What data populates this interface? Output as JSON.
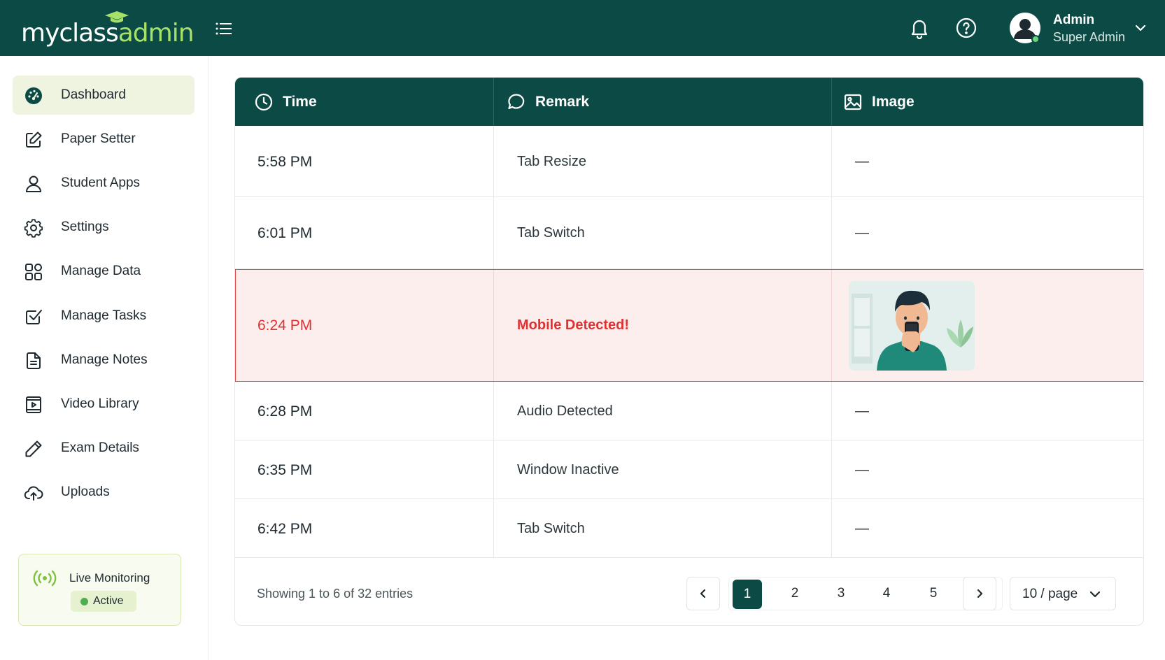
{
  "app": {
    "logo_main": "myclass",
    "logo_accent": "admin"
  },
  "header": {
    "user_name": "Admin",
    "user_role": "Super Admin"
  },
  "sidebar": {
    "items": [
      {
        "label": "Dashboard",
        "icon": "dashboard-icon",
        "active": true
      },
      {
        "label": "Paper Setter",
        "icon": "edit-icon"
      },
      {
        "label": "Student Apps",
        "icon": "user-icon"
      },
      {
        "label": "Settings",
        "icon": "gear-icon"
      },
      {
        "label": "Manage Data",
        "icon": "grid-icon"
      },
      {
        "label": "Manage Tasks",
        "icon": "checkbox-icon"
      },
      {
        "label": "Manage Notes",
        "icon": "note-icon"
      },
      {
        "label": "Video Library",
        "icon": "video-icon"
      },
      {
        "label": "Exam Details",
        "icon": "pencil-icon"
      },
      {
        "label": "Uploads",
        "icon": "upload-cloud-icon"
      }
    ],
    "live": {
      "label": "Live Monitoring",
      "status": "Active"
    }
  },
  "table": {
    "columns": {
      "time": "Time",
      "remark": "Remark",
      "image": "Image"
    },
    "rows": [
      {
        "time": "5:58 PM",
        "remark": "Tab Resize",
        "image": "—"
      },
      {
        "time": "6:01 PM",
        "remark": "Tab Switch",
        "image": "—"
      },
      {
        "time": "6:24 PM",
        "remark": "Mobile Detected!",
        "image": "snapshot",
        "alert": true
      },
      {
        "time": "6:28 PM",
        "remark": "Audio Detected",
        "image": "—"
      },
      {
        "time": "6:35 PM",
        "remark": "Window Inactive",
        "image": "—"
      },
      {
        "time": "6:42 PM",
        "remark": "Tab Switch",
        "image": "—"
      }
    ]
  },
  "pagination": {
    "info": "Showing 1 to 6 of 32 entries",
    "pages": [
      "1",
      "2",
      "3",
      "4",
      "5"
    ],
    "current_page": "1",
    "page_size": "10 / page"
  },
  "colors": {
    "primary": "#0c4a45",
    "accent": "#a6e26a",
    "alert": "#e03131"
  }
}
